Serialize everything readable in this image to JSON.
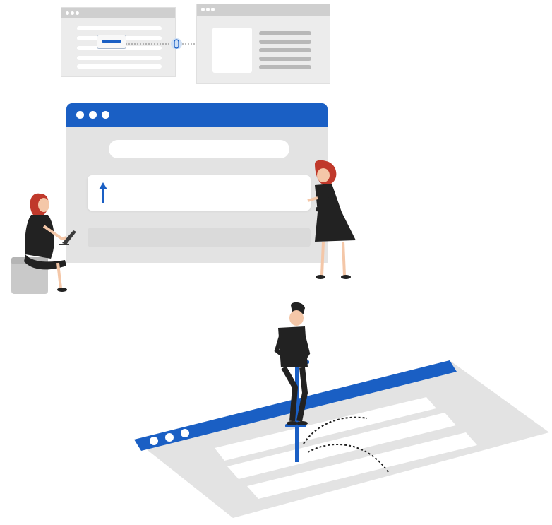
{
  "illustration": {
    "colors": {
      "accent_blue": "#1a5fc4",
      "window_gray": "#e3e3e3",
      "titlebar_gray": "#cfcfcf",
      "figure_dark": "#222222",
      "hair_red": "#c0392b"
    },
    "icons": [
      "upload-arrow-icon",
      "link-connector-icon"
    ]
  }
}
